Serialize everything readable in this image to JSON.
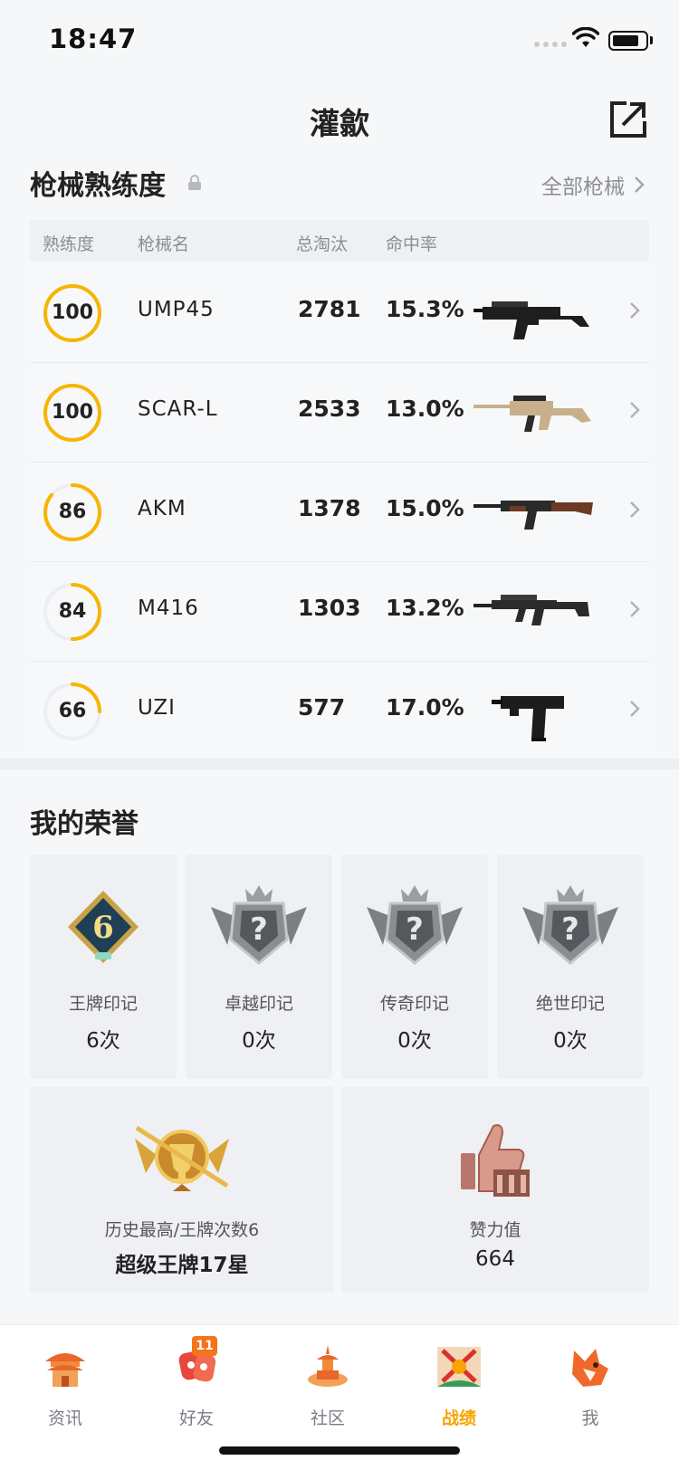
{
  "status_bar": {
    "time": "18:47"
  },
  "header": {
    "title": "灌歙"
  },
  "weapons": {
    "section_title": "枪械熟练度",
    "all_link": "全部枪械",
    "columns": {
      "proficiency": "熟练度",
      "name": "枪械名",
      "kills": "总淘汰",
      "hit_rate": "命中率"
    },
    "rows": [
      {
        "proficiency": "100",
        "progress": 1.0,
        "name": "UMP45",
        "kills": "2781",
        "hit_rate": "15.3%",
        "gun_icon": "smg-ump45-icon"
      },
      {
        "proficiency": "100",
        "progress": 1.0,
        "name": "SCAR-L",
        "kills": "2533",
        "hit_rate": "13.0%",
        "gun_icon": "rifle-scar-icon"
      },
      {
        "proficiency": "86",
        "progress": 0.86,
        "name": "AKM",
        "kills": "1378",
        "hit_rate": "15.0%",
        "gun_icon": "rifle-akm-icon"
      },
      {
        "proficiency": "84",
        "progress": 0.5,
        "name": "M416",
        "kills": "1303",
        "hit_rate": "13.2%",
        "gun_icon": "rifle-m416-icon"
      },
      {
        "proficiency": "66",
        "progress": 0.25,
        "name": "UZI",
        "kills": "577",
        "hit_rate": "17.0%",
        "gun_icon": "smg-uzi-icon"
      }
    ]
  },
  "honor": {
    "section_title": "我的荣誉",
    "marks": [
      {
        "label": "王牌印记",
        "count": "6次",
        "badge_number": "6",
        "icon": "ace-mark-icon"
      },
      {
        "label": "卓越印记",
        "count": "0次",
        "badge_number": "?",
        "icon": "excellence-mark-icon"
      },
      {
        "label": "传奇印记",
        "count": "0次",
        "badge_number": "?",
        "icon": "legend-mark-icon"
      },
      {
        "label": "绝世印记",
        "count": "0次",
        "badge_number": "?",
        "icon": "peerless-mark-icon"
      }
    ],
    "highest": {
      "label": "历史最高/王牌次数6",
      "value": "超级王牌17星",
      "icon": "super-ace-badge-icon"
    },
    "likes": {
      "label": "赞力值",
      "value": "664",
      "icon": "thumbs-up-icon"
    }
  },
  "tab_bar": {
    "tabs": [
      {
        "label": "资讯",
        "icon": "pavilion-icon",
        "active": false
      },
      {
        "label": "好友",
        "icon": "friends-icon",
        "active": false,
        "badge": "11"
      },
      {
        "label": "社区",
        "icon": "community-icon",
        "active": false
      },
      {
        "label": "战绩",
        "icon": "battle-record-icon",
        "active": true
      },
      {
        "label": "我",
        "icon": "fox-profile-icon",
        "active": false
      }
    ]
  },
  "colors": {
    "accent": "#f7b500",
    "active_tab": "#f7a400",
    "badge": "#f5731b"
  }
}
